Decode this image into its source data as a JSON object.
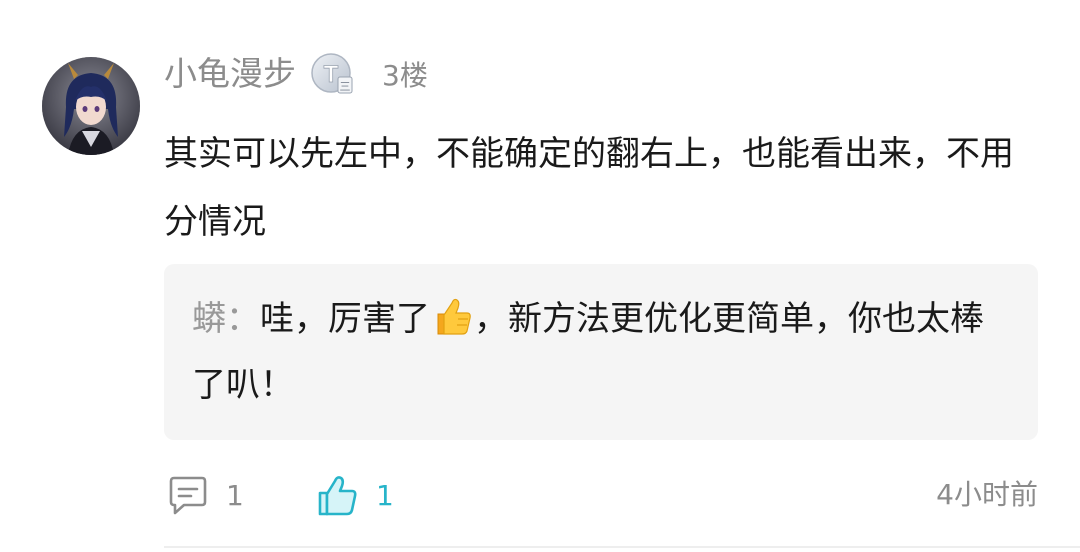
{
  "comment": {
    "username": "小龟漫步",
    "badge_letter": "T",
    "badge_sub": "三",
    "floor": "3楼",
    "content": "其实可以先左中，不能确定的翻右上，也能看出来，不用分情况"
  },
  "reply": {
    "author": "蟒",
    "separator": "：",
    "text_before_emoji": "哇，厉害了",
    "emoji": "thumbs-up-emoji",
    "text_after_emoji": "，新方法更优化更简单，你也太棒了叭！"
  },
  "footer": {
    "reply_icon": "comment-icon",
    "reply_count": "1",
    "like_icon": "thumbs-up-icon",
    "like_count": "1",
    "timestamp": "4小时前"
  },
  "colors": {
    "meta_gray": "#8c8c8c",
    "text": "#1a1a1a",
    "reply_bg": "#f5f5f5",
    "accent": "#27b4c9"
  }
}
